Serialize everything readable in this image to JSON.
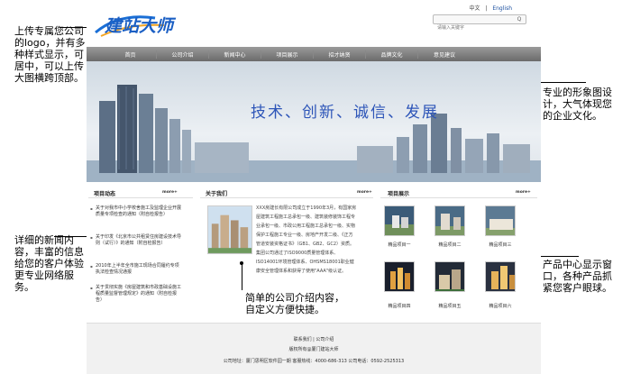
{
  "site": {
    "logo_text": "建站大师",
    "lang": {
      "zh": "中文",
      "sep": "|",
      "en": "English"
    },
    "search": {
      "placeholder": "请输入关键字",
      "button": "Q"
    },
    "nav": [
      "首页",
      "公司介绍",
      "新闻中心",
      "项目展示",
      "招才纳贤",
      "品牌文化",
      "意见建议"
    ],
    "banner_slogan": "技术、创新、诚信、发展",
    "news": {
      "title": "项目动态",
      "more": "more+",
      "items": [
        "关于对我市中小学校舍施工及监理企业开展质量专项检查的通知（附自检报告）",
        "关于印发《北京市公共租赁住房建设技术导则（试行）》的通知（附自检报告）",
        "2010年上半年全市施工现场合同履约专项执法检查情况通报",
        "关于贯彻实施《房屋建筑和市政基础设施工程质量监督管理规定》的通知（附自检报告）"
      ]
    },
    "about": {
      "title": "关于我们",
      "more": "more+",
      "text": "XXX房建长有限公司成立于1990年3月，有国家房屋建筑工程施工总承包一级、建筑装修装饰工程专业承包一级、市政公用工程施工总承包一级、实物保护工程施工专业一级、房地产开发二级、《正方管道安装资格证书》（GB1、GB2、GC2）资质。集团公司通过了ISO9000质量管理体系、ISO14001环境管理体系、OHSMS18001职业健康安全管理体系和获得了使用\"AAA\"级认证。"
    },
    "projects": {
      "title": "项目展示",
      "more": "more+",
      "items": [
        "精品项目一",
        "精品项目二",
        "精品项目三",
        "精品项目四",
        "精品项目五",
        "精品项目六"
      ]
    },
    "footer": {
      "links": "联系我们 | 公司介绍",
      "copyright": "版权所有@厦门建站大师",
      "address": "公司地址：厦门思明区软件园一期 客服热线：4000-686-313 公司电话：0592-2525313"
    }
  },
  "callouts": {
    "logo": "上传专属您公司的logo，并有多种样式显示，可居中，可以上传大图横跨顶部。",
    "banner": "专业的形象图设计，大气体现您的企业文化。",
    "news": "详细的新闻内容，丰富的信息给您的客户体验更专业网络服务。",
    "about": "简单的公司介绍内容，自定义方便快捷。",
    "products": "产品中心显示窗口，各种产品抓紧您客户眼球。"
  }
}
